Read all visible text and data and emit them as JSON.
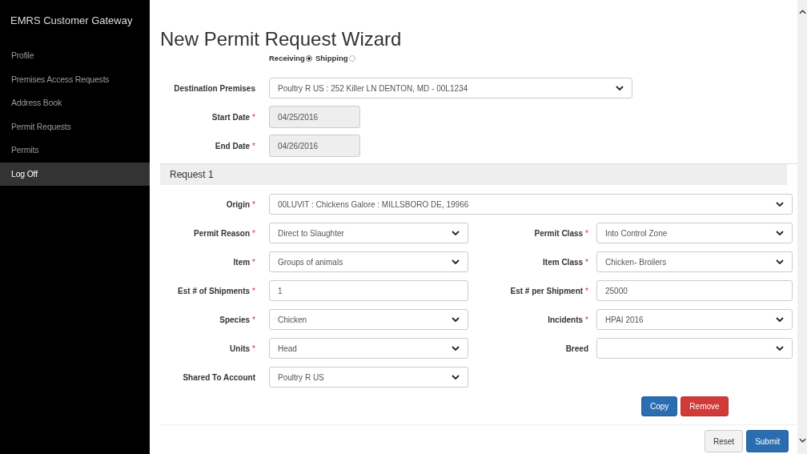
{
  "sidebar": {
    "brand": "EMRS Customer Gateway",
    "items": [
      {
        "label": "Profile",
        "selected": false
      },
      {
        "label": "Premises Access Requests",
        "selected": false
      },
      {
        "label": "Address Book",
        "selected": false
      },
      {
        "label": "Permit Requests",
        "selected": false
      },
      {
        "label": "Permits",
        "selected": false
      },
      {
        "label": "Log Off",
        "selected": true
      }
    ]
  },
  "title": "New Permit Request Wizard",
  "direction": [
    {
      "label": "Receiving",
      "selected": true
    },
    {
      "label": "Shipping",
      "selected": false
    }
  ],
  "top_fields": [
    {
      "label": "Destination Premises",
      "kind": "select",
      "value": "Poultry R US : 252 Killer LN DENTON, MD - 00L1234"
    },
    {
      "label": "Start Date",
      "required_mark": "*",
      "kind": "date",
      "value": "04/25/2016"
    },
    {
      "label": "End Date",
      "required_mark": "*",
      "kind": "date",
      "value": "04/26/2016"
    }
  ],
  "request": {
    "title": "Request 1",
    "origin": {
      "label": "Origin",
      "required_mark": "*",
      "kind": "select",
      "value": "00LUVIT : Chickens Galore : MILLSBORO DE, 19966"
    },
    "rows": [
      {
        "left": {
          "label": "Permit Reason",
          "required_mark": "*",
          "kind": "select",
          "value": "Direct to Slaughter"
        },
        "right": {
          "label": "Permit Class",
          "required_mark": "*",
          "kind": "select",
          "value": "Into Control Zone"
        }
      },
      {
        "left": {
          "label": "Item",
          "required_mark": "*",
          "kind": "select",
          "value": "Groups of animals"
        },
        "right": {
          "label": "Item Class",
          "required_mark": "*",
          "kind": "select",
          "value": "Chicken- Broilers"
        }
      },
      {
        "left": {
          "label": "Est # of Shipments",
          "required_mark": "*",
          "kind": "text",
          "value": "1"
        },
        "right": {
          "label": "Est # per Shipment",
          "required_mark": "*",
          "kind": "text",
          "value": "25000"
        }
      },
      {
        "left": {
          "label": "Species",
          "required_mark": "*",
          "kind": "select",
          "value": "Chicken"
        },
        "right": {
          "label": "Incidents",
          "required_mark": "*",
          "kind": "select",
          "value": "HPAI 2016"
        }
      },
      {
        "left": {
          "label": "Units",
          "required_mark": "*",
          "kind": "select",
          "value": "Head"
        },
        "right": {
          "label": "Breed",
          "kind": "select"
        }
      },
      {
        "left": {
          "label": "Shared To Account",
          "kind": "select",
          "value": "Poultry R US"
        }
      }
    ],
    "buttons": [
      {
        "label": "Copy",
        "kind": "primary"
      },
      {
        "label": "Remove",
        "kind": "danger"
      }
    ]
  },
  "footer_buttons": [
    {
      "label": "Reset",
      "kind": "default"
    },
    {
      "label": "Submit",
      "kind": "primary"
    }
  ]
}
